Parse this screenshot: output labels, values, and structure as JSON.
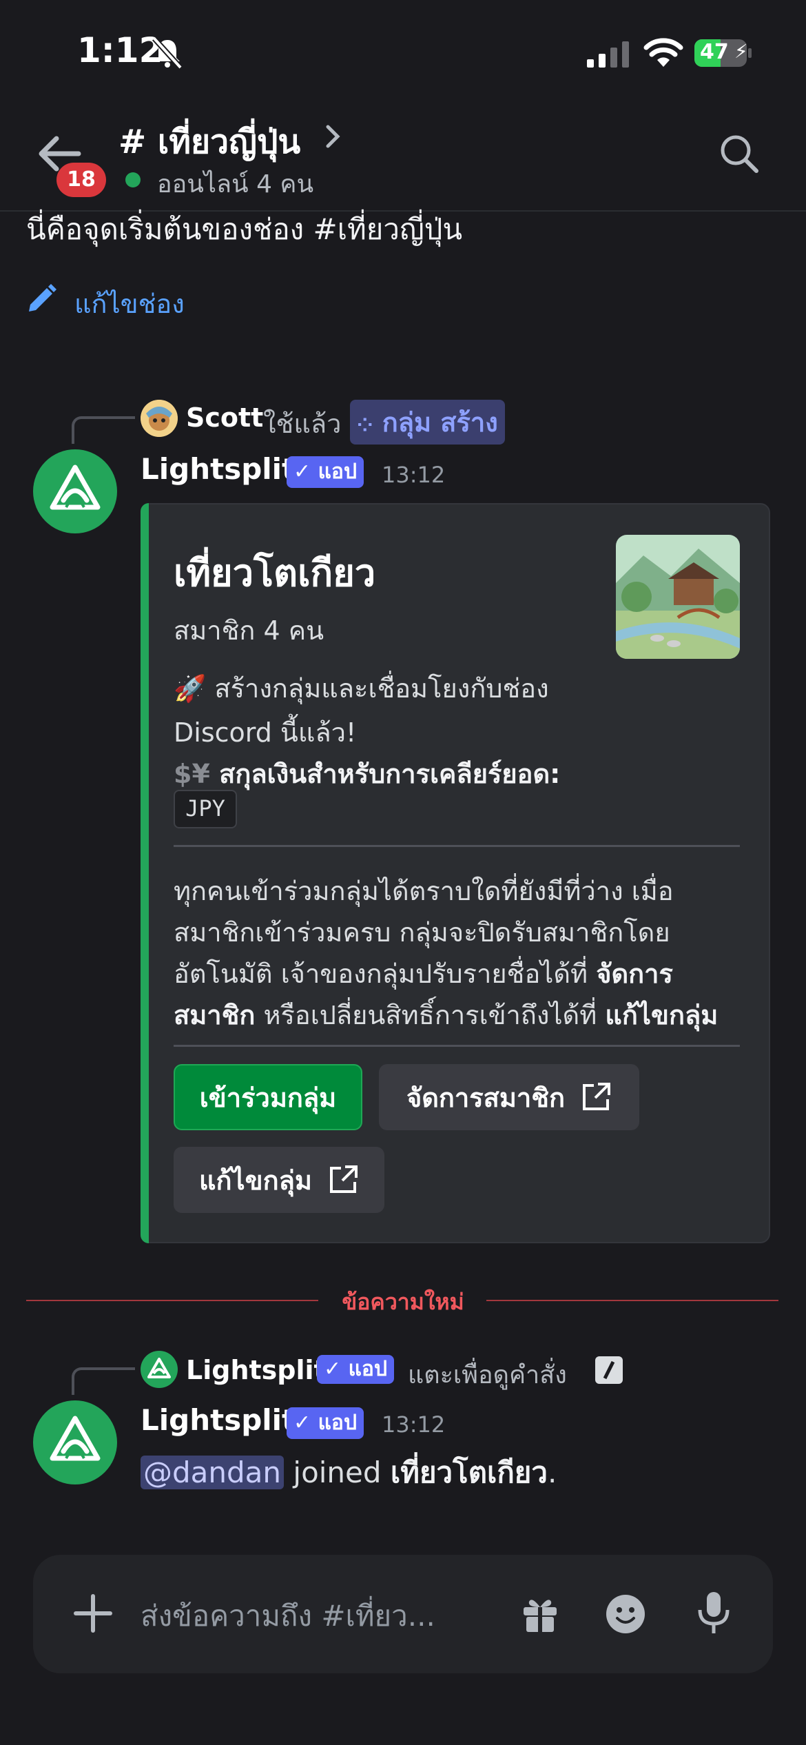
{
  "status_bar": {
    "time": "1:12",
    "battery": "47"
  },
  "header": {
    "unread_badge": "18",
    "channel_title": "# เที่ยวญี่ปุ่น",
    "subtitle": "ออนไลน์ 4 คน"
  },
  "intro": {
    "text": "นี่คือจุดเริ่มต้นของช่อง #เที่ยวญี่ปุ่น",
    "edit_label": "แก้ไขช่อง"
  },
  "message1": {
    "reply_user": "Scott",
    "reply_used": "ใช้แล้ว",
    "command": "กลุ่ม สร้าง",
    "author": "Lightsplit",
    "app_tag": "แอป",
    "timestamp": "13:12",
    "embed": {
      "title": "เที่ยวโตเกียว",
      "members": "สมาชิก 4 คน",
      "line1": "สร้างกลุ่มและเชื่อมโยงกับช่อง",
      "line2": "Discord นี้แล้ว!",
      "currency_label": "สกุลเงินสำหรับการเคลียร์ยอด:",
      "currency_code": "JPY",
      "desc_l1": "ทุกคนเข้าร่วมกลุ่มได้ตราบใดที่ยังมีที่ว่าง เมื่อ",
      "desc_l2": "สมาชิกเข้าร่วมครบ กลุ่มจะปิดรับสมาชิกโดย",
      "desc_l3a": "อัตโนมัติ เจ้าของกลุ่มปรับรายชื่อได้ที่ ",
      "desc_l3b": "จัดการ",
      "desc_l4a": "สมาชิก",
      "desc_l4b": " หรือเปลี่ยนสิทธิ์การเข้าถึงได้ที่ ",
      "desc_l4c": "แก้ไขกลุ่ม",
      "buttons": {
        "join": "เข้าร่วมกลุ่ม",
        "manage": "จัดการสมาชิก",
        "edit": "แก้ไขกลุ่ม"
      }
    }
  },
  "new_messages_label": "ข้อความใหม่",
  "message2": {
    "reply_user": "Lightsplit",
    "reply_tag": "แอป",
    "reply_hint": "แตะเพื่อดูคำสั่ง",
    "author": "Lightsplit",
    "app_tag": "แอป",
    "timestamp": "13:12",
    "mention": "@dandan",
    "text_mid": " joined ",
    "text_group": "เที่ยวโตเกียว",
    "text_end": "."
  },
  "composer": {
    "placeholder": "ส่งข้อความถึง #เที่ยว..."
  },
  "colors": {
    "accent_green": "#23a55a",
    "blurple": "#5865f2",
    "danger": "#da373c",
    "link": "#5aa2ff"
  }
}
